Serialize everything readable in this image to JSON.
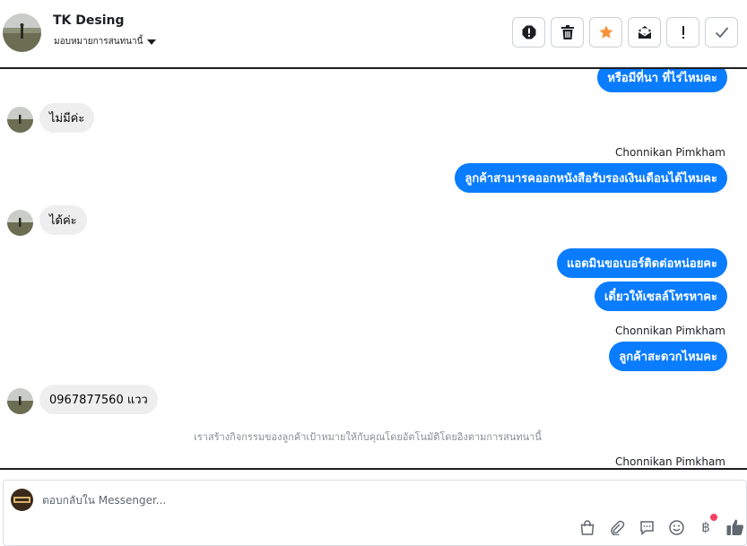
{
  "header": {
    "contact_name": "TK Desing",
    "assign_label": "มอบหมายการสนทนานี้",
    "actions": [
      "spam-icon",
      "trash-icon",
      "star-icon",
      "mark-unread-icon",
      "follow-up-icon",
      "done-icon"
    ]
  },
  "messages": {
    "m1": "หรือมีที่นา ที่ไร่ไหมคะ",
    "m2": "ไม่มีค่ะ",
    "m3_sender": "Chonnikan Pimkham",
    "m3": "ลูกค้าสามารคออกหนังสือรับรองเงินเดือนได้ไหมคะ",
    "m4": "ได้ค่ะ",
    "m5": "แอดมินขอเบอร์ติดต่อหน่อยคะ",
    "m6": "เดี๋ยวให้เซลล์โทรหาคะ",
    "m7_sender": "Chonnikan Pimkham",
    "m7": "ลูกค้าสะดวกไหมคะ",
    "m8": "0967877560 แวว",
    "system_note": "เราสร้างกิจกรรมของลูกค้าเป้าหมายให้กับคุณโดยอัตโนมัติโดยอิงตามการสนทนานี้",
    "m9_sender": "Chonnikan Pimkham"
  },
  "composer": {
    "placeholder": "ตอบกลับใน Messenger...",
    "tools": [
      "shopping-bag-icon",
      "attachment-icon",
      "saved-reply-icon",
      "emoji-icon",
      "baht-payment-icon",
      "like-icon"
    ],
    "baht_symbol": "฿",
    "colors": {
      "accent": "#0a7cff",
      "like": "#606770",
      "notify": "#f3425f",
      "star": "#f7923b"
    }
  }
}
